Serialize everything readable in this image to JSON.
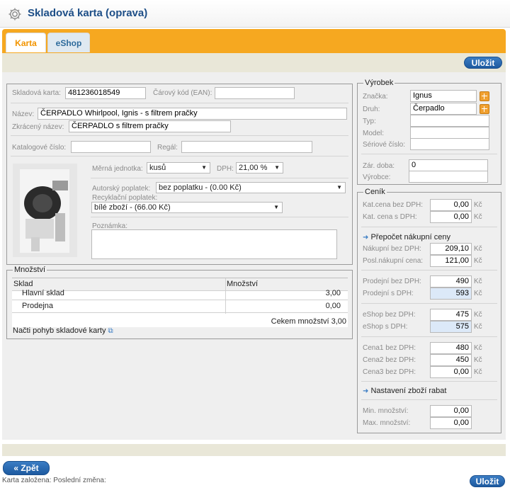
{
  "header": {
    "title": "Skladová karta (oprava)",
    "icon": "gear-icon"
  },
  "tabs": [
    {
      "label": "Karta",
      "active": true
    },
    {
      "label": "eShop",
      "active": false
    }
  ],
  "buttons": {
    "save": "Uložit",
    "back": "« Zpět",
    "save_bottom": "Uložit"
  },
  "card": {
    "card_label": "Skladová karta:",
    "card_value": "481236018549",
    "ean_label": "Čárový kód (EAN):",
    "ean_value": "",
    "name_label": "Název:",
    "name_value": "ČERPADLO Whirlpool, Ignis - s filtrem pračky",
    "short_label": "Zkrácený název:",
    "short_value": "ČERPADLO s filtrem pračky",
    "catalog_label": "Katalogové číslo:",
    "catalog_value": "",
    "shelf_label": "Regál:",
    "shelf_value": "",
    "unit_label": "Měrná jednotka:",
    "unit_value": "kusů",
    "vat_label": "DPH:",
    "vat_value": "21,00 %",
    "author_fee_label": "Autorský poplatek:",
    "author_fee_value": "bez poplatku - (0.00 Kč)",
    "recycle_fee_label": "Recyklační poplatek:",
    "recycle_fee_value": "bílé zboží - (66.00 Kč)",
    "note_label": "Poznámka:",
    "note_value": ""
  },
  "quantity": {
    "legend": "Množství",
    "col_warehouse": "Sklad",
    "col_qty": "Množství",
    "rows": [
      {
        "name": "Hlavní sklad",
        "qty": "3,00"
      },
      {
        "name": "Prodejna",
        "qty": "0,00"
      }
    ],
    "total": "Cekem množství 3,00",
    "movement_link": "Načti pohyb skladové karty"
  },
  "product": {
    "legend": "Výrobek",
    "brand_label": "Značka:",
    "brand_value": "Ignus",
    "type_label": "Druh:",
    "type_value": "Čerpadlo",
    "kind_label": "Typ:",
    "kind_value": "",
    "model_label": "Model:",
    "model_value": "",
    "serial_label": "Sériové číslo:",
    "serial_value": "",
    "warranty_label": "Zár. doba:",
    "warranty_value": "0",
    "maker_label": "Výrobce:",
    "maker_value": ""
  },
  "pricelist": {
    "legend": "Ceník",
    "currency": "Kč",
    "cat_no_vat_label": "Kat.cena bez DPH:",
    "cat_no_vat": "0,00",
    "cat_vat_label": "Kat. cena s DPH:",
    "cat_vat": "0,00",
    "recalc_link": "Přepočet nákupní ceny",
    "buy_no_vat_label": "Nákupní bez DPH:",
    "buy_no_vat": "209,10",
    "last_buy_label": "Posl.nákupní cena:",
    "last_buy": "121,00",
    "sell_no_vat_label": "Prodejní bez DPH:",
    "sell_no_vat": "490",
    "sell_vat_label": "Prodejní s DPH:",
    "sell_vat": "593",
    "eshop_no_vat_label": "eShop bez DPH:",
    "eshop_no_vat": "475",
    "eshop_vat_label": "eShop s DPH:",
    "eshop_vat": "575",
    "price1_label": "Cena1 bez DPH:",
    "price1": "480",
    "price2_label": "Cena2 bez DPH:",
    "price2": "450",
    "price3_label": "Cena3 bez DPH:",
    "price3": "0,00",
    "discount_link": "Nastavení zboží rabat",
    "min_qty_label": "Min. množství:",
    "min_qty": "0,00",
    "max_qty_label": "Max. množství:",
    "max_qty": "0,00"
  },
  "footer": {
    "info": "Karta založena:  Poslední změna:"
  }
}
